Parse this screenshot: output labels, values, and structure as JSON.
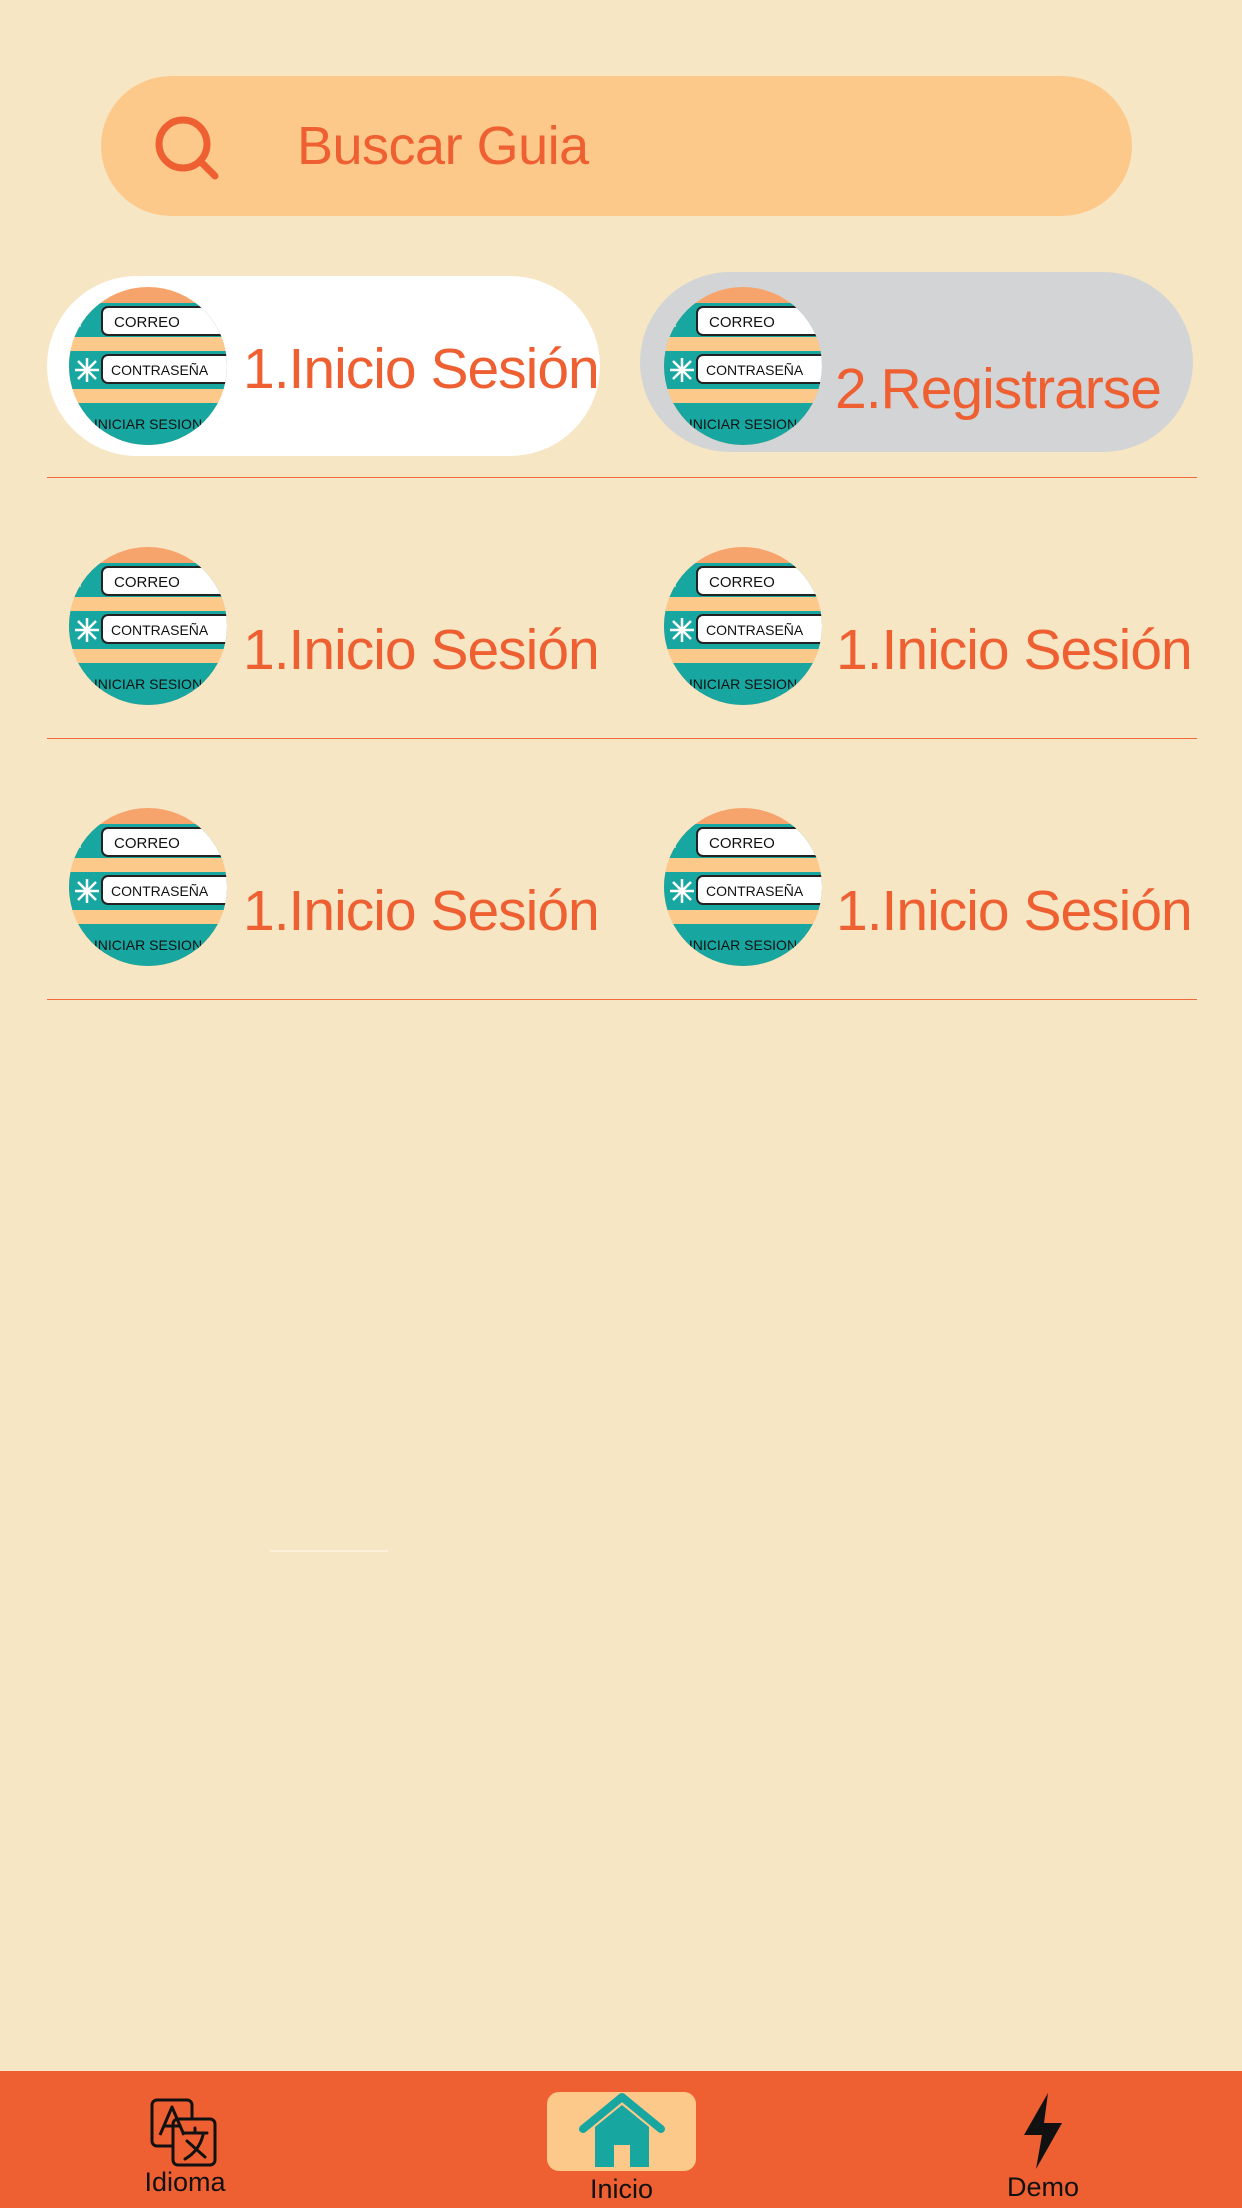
{
  "search": {
    "placeholder": "Buscar Guia",
    "icon": "search-icon"
  },
  "thumbnail": {
    "field_email": "CORREO",
    "field_password": "CONTRASEÑA",
    "button_login": "INICIAR SESION"
  },
  "guides": [
    {
      "label": "1.Inicio Sesión"
    },
    {
      "label": "2.Registrarse"
    },
    {
      "label": "1.Inicio Sesión"
    },
    {
      "label": "1.Inicio Sesión"
    },
    {
      "label": "1.Inicio Sesión"
    },
    {
      "label": "1.Inicio Sesión"
    }
  ],
  "tabbar": {
    "items": [
      {
        "label": "Idioma",
        "icon": "translate-icon"
      },
      {
        "label": "Inicio",
        "icon": "home-icon",
        "active": true
      },
      {
        "label": "Demo",
        "icon": "lightning-icon"
      }
    ]
  },
  "colors": {
    "background": "#f7e6c4",
    "accent": "#ee5f32",
    "search_bg": "#fdc98b",
    "teal": "#17a6a0",
    "selected_bg": "#ffffff",
    "pressed_bg": "#d3d4d6"
  }
}
